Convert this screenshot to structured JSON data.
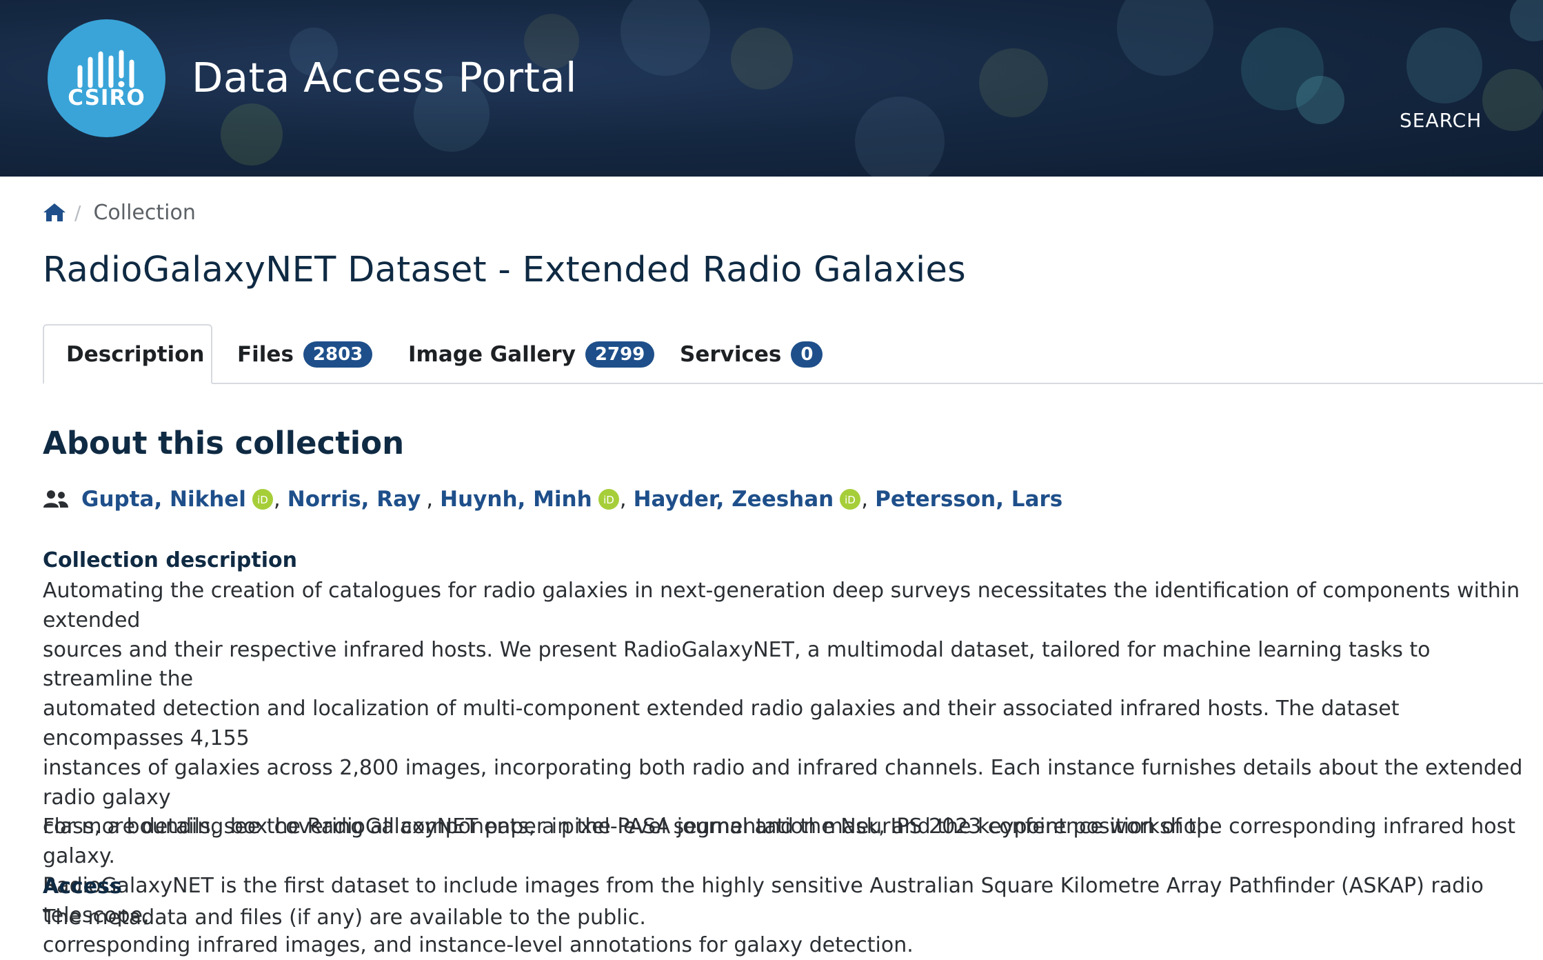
{
  "header": {
    "logo_text": "CSIRO",
    "app_title": "Data Access Portal",
    "search_label": "SEARCH"
  },
  "breadcrumb": {
    "current": "Collection"
  },
  "page_title": "RadioGalaxyNET Dataset - Extended Radio Galaxies",
  "tabs": [
    {
      "label": "Description",
      "count": null,
      "active": true
    },
    {
      "label": "Files",
      "count": "2803"
    },
    {
      "label": "Image Gallery",
      "count": "2799"
    },
    {
      "label": "Services",
      "count": "0"
    }
  ],
  "about": {
    "heading": "About this collection",
    "authors": [
      {
        "name": "Gupta, Nikhel",
        "orcid": true
      },
      {
        "name": "Norris, Ray",
        "orcid": false
      },
      {
        "name": "Huynh, Minh",
        "orcid": true
      },
      {
        "name": "Hayder, Zeeshan",
        "orcid": true
      },
      {
        "name": "Petersson, Lars",
        "orcid": false
      }
    ],
    "description_label": "Collection description",
    "description_lines": [
      "Automating the creation of catalogues for radio galaxies in next-generation deep surveys necessitates the identification of components within extended",
      "sources and their respective infrared hosts. We present RadioGalaxyNET, a multimodal dataset, tailored for machine learning tasks to streamline the",
      "automated detection and localization of multi-component extended radio galaxies and their associated infrared hosts. The dataset encompasses 4,155",
      "instances of galaxies across 2,800 images, incorporating both radio and infrared channels. Each instance furnishes details about the extended radio galaxy",
      "class, a bounding box covering all components, a pixel-level segmentation mask, and the keypoint position of the corresponding infrared host galaxy.",
      "RadioGalaxyNET is the first dataset to include images from the highly sensitive Australian Square Kilometre Array Pathfinder (ASKAP) radio telescope,",
      "corresponding infrared images, and instance-level annotations for galaxy detection."
    ],
    "more_details": "For more details, see the RadioGalaxyNET paper in the PASA journal and the NeurIPS 2023 conference workshop.",
    "access_label": "Access",
    "access_text": "The metadata and files (if any) are available to the public."
  },
  "colors": {
    "header_bg": "#152842",
    "logo_blue": "#3aa4d8",
    "link_blue": "#1e4f8a",
    "badge_blue": "#1e4f8a",
    "title_navy": "#0f2a43",
    "orcid_green": "#a6ce39"
  }
}
